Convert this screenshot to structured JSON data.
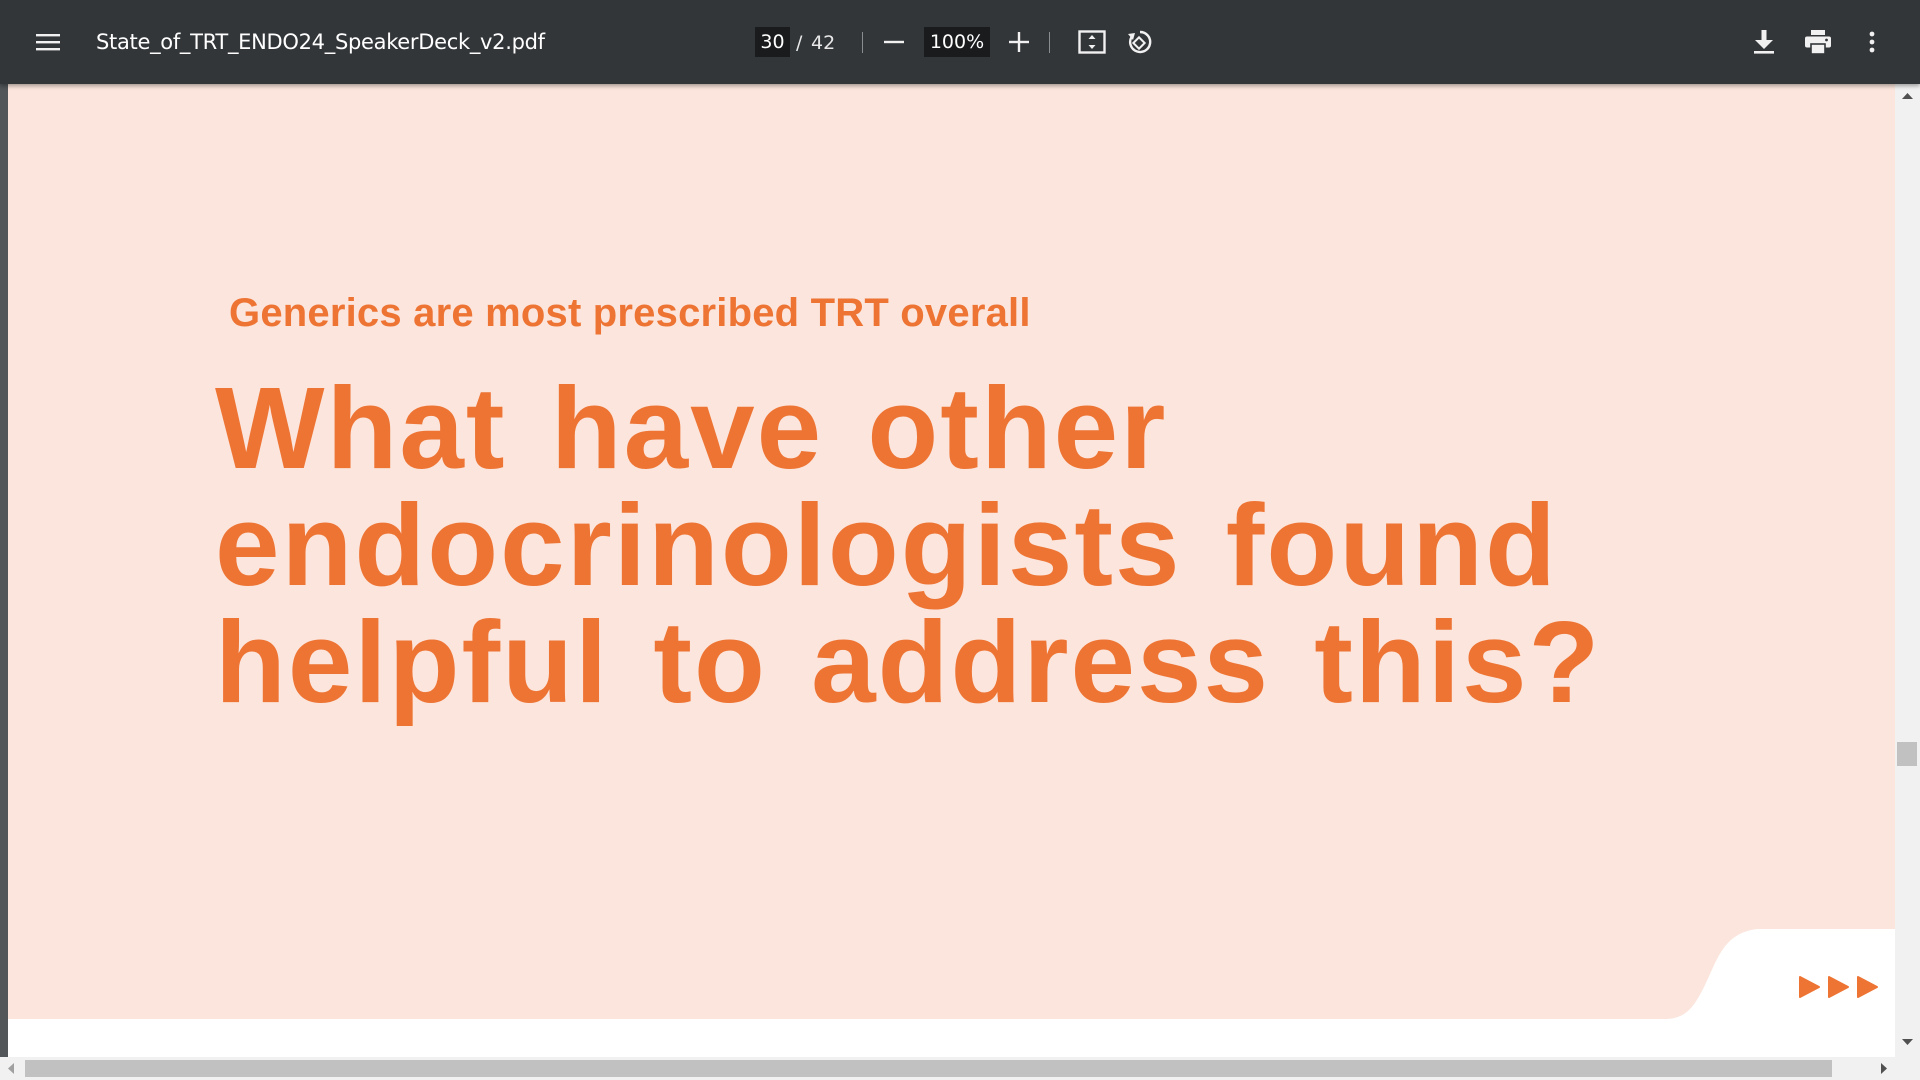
{
  "toolbar": {
    "file_name": "State_of_TRT_ENDO24_SpeakerDeck_v2.pdf",
    "page_current": "30",
    "page_separator": "/",
    "page_total": "42",
    "zoom_value": "100%"
  },
  "slide": {
    "subtitle": "Generics are most prescribed TRT overall",
    "headline_lines": [
      "What have other",
      "endocrinologists found",
      "helpful to address this?"
    ]
  },
  "colors": {
    "toolbar_bg": "#323639",
    "slide_bg": "#fbe5dc",
    "accent_orange": "#ee7434"
  },
  "icons": {
    "menu": "hamburger-icon",
    "zoom_out": "minus-icon",
    "zoom_in": "plus-icon",
    "fit": "fit-to-page-icon",
    "rotate": "rotate-icon",
    "download": "download-icon",
    "print": "print-icon",
    "more": "more-vert-icon",
    "slide_arrows": "play-arrows-icon"
  }
}
